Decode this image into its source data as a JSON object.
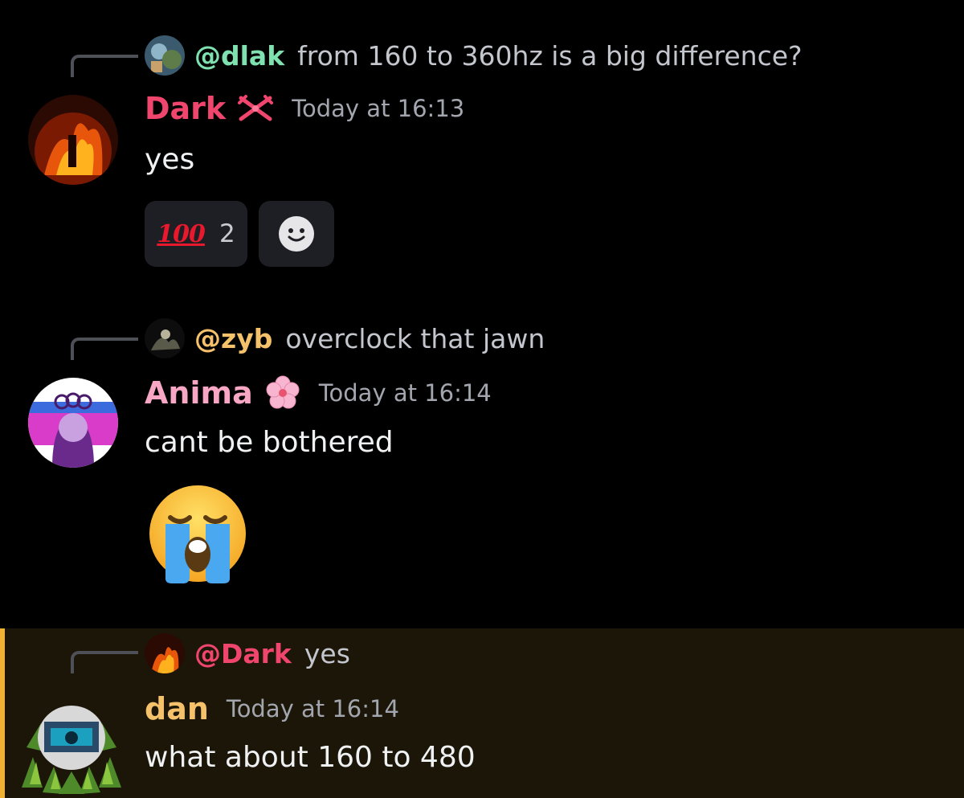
{
  "messages": [
    {
      "reply": {
        "mention": "@dlak",
        "text": "from 160 to 360hz is a big difference?"
      },
      "author": "Dark",
      "timestamp": "Today at 16:13",
      "content": "yes",
      "reactions": [
        {
          "emoji": "100",
          "count": "2"
        }
      ],
      "author_color": "#f0466e"
    },
    {
      "reply": {
        "mention": "@zyb",
        "text": "overclock that jawn"
      },
      "author": "Anima",
      "timestamp": "Today at 16:14",
      "content": "cant be bothered",
      "author_color": "#f7a7c3"
    },
    {
      "reply": {
        "mention": "@Dark",
        "text": "yes"
      },
      "author": "dan",
      "timestamp": "Today at 16:14",
      "content": "what about 160 to 480",
      "author_color": "#f5c26b",
      "highlighted": true
    }
  ],
  "colors": {
    "background": "#000000",
    "mention_highlight_bg": "#1b1608",
    "mention_highlight_bar": "#f0b232",
    "mention_dlak": "#7fe0b0",
    "mention_zyb": "#f5c26b",
    "mention_dark": "#f0466e",
    "timestamp": "#a3a6ae"
  },
  "icons": {
    "dark_role": "crossed-swords-icon",
    "anima_role": "cherry-blossom-icon",
    "add_reaction": "smiley-face-icon",
    "big_emoji": "loudly-crying-face-emoji"
  }
}
